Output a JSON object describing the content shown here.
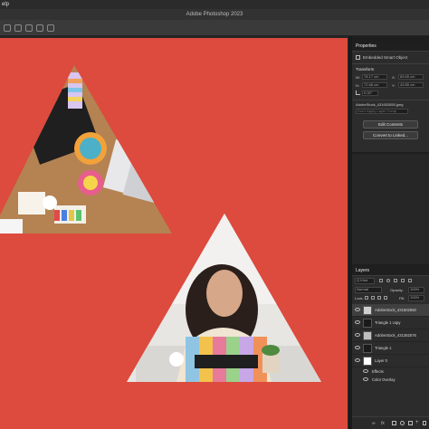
{
  "menubar": {
    "label": "elp"
  },
  "window": {
    "title": "Adobe Photoshop 2023"
  },
  "colors": {
    "canvas": "#dc4b3e",
    "panel": "#2c2c2c",
    "accent": "#3f7fd9"
  },
  "properties": {
    "tab": "Properties",
    "object_type": "Embedded Smart Object",
    "section": "Transform",
    "w_label": "W:",
    "w_value": "78.17 cm",
    "x_label": "X:",
    "x_value": "69.65 cm",
    "h_label": "H:",
    "h_value": "72.68 cm",
    "y_label": "Y:",
    "y_value": "43.85 cm",
    "angle_value": "0.00°",
    "filename": "AdobeStock_431602650.jpeg",
    "layer_comp_placeholder": "Don't Apply Layer Comp",
    "edit_button": "Edit Contents",
    "convert_button": "Convert to Linked..."
  },
  "layers": {
    "tab": "Layers",
    "filter": "Q Kind",
    "blend_mode": "Normal",
    "opacity_label": "Opacity:",
    "opacity_value": "100%",
    "lock_label": "Lock:",
    "fill_label": "Fill:",
    "fill_value": "100%",
    "rows": [
      {
        "name": "AdobeStock_431602650"
      },
      {
        "name": "Triangle 1 copy"
      },
      {
        "name": "AdobeStock_431362576"
      },
      {
        "name": "Triangle 1"
      },
      {
        "name": "Layer 0"
      },
      {
        "name": "Effects"
      },
      {
        "name": "Color Overlay"
      }
    ]
  }
}
